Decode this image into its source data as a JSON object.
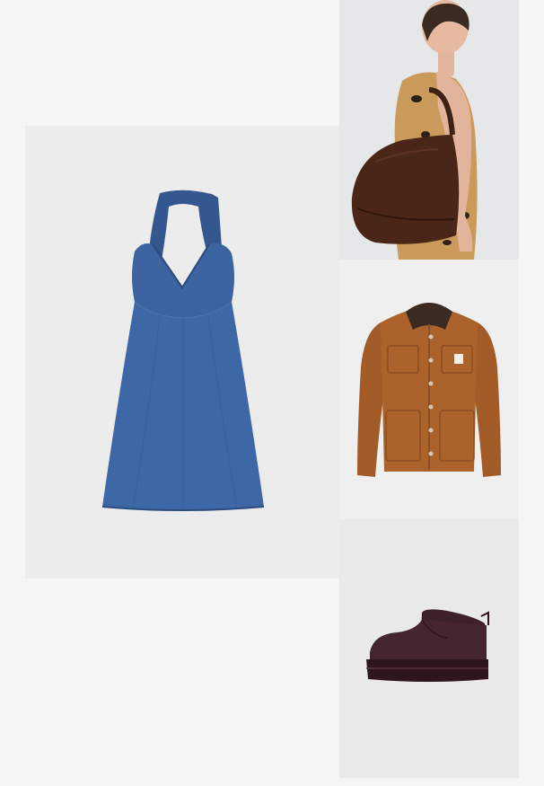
{
  "products": [
    {
      "image_subject": "denim-halter-dress",
      "accent": "#3a62a0"
    },
    {
      "image_subject": "model-with-brown-leather-shoulder-bag",
      "accent": "#4a2618"
    },
    {
      "image_subject": "brown-canvas-work-jacket",
      "accent": "#a65f2a"
    },
    {
      "image_subject": "burgundy-platform-ankle-boot",
      "accent": "#3b2027"
    }
  ],
  "colors": {
    "page_background": "#f5f5f5",
    "tile_background": "#ececec"
  }
}
